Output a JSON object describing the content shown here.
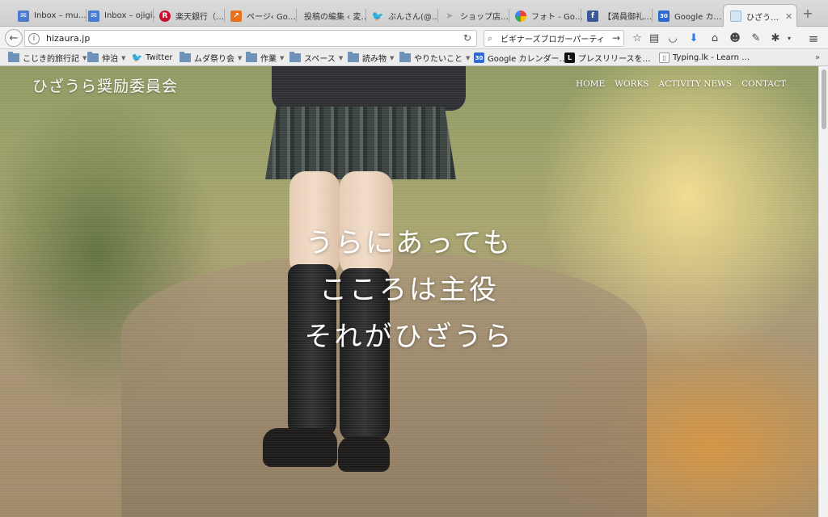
{
  "tabs": [
    {
      "label": "Inbox – mu…",
      "icon": "gmail-icon",
      "color": "#4a7bd0"
    },
    {
      "label": "Inbox – ojigi…",
      "icon": "gmail-icon",
      "color": "#4a7bd0"
    },
    {
      "label": "楽天銀行（…",
      "icon": "rakuten-icon",
      "color": "#c8102e"
    },
    {
      "label": "ページ‹ Go…",
      "icon": "analytics-icon",
      "color": "#e8711c"
    },
    {
      "label": "投稿の編集 ‹ 変…",
      "icon": "",
      "color": ""
    },
    {
      "label": "ぶんさん(@…",
      "icon": "twitter-icon",
      "color": "#1da1f2"
    },
    {
      "label": "ショップ店…",
      "icon": "send-icon",
      "color": "#9aa3ad"
    },
    {
      "label": "フォト - Go…",
      "icon": "photos-icon",
      "color": "#e3a21a"
    },
    {
      "label": "【満員御礼…",
      "icon": "facebook-icon",
      "color": "#3b5998"
    },
    {
      "label": "Google カ…",
      "icon": "calendar-icon",
      "color": "#2f6ad0"
    },
    {
      "label": "ひざう…",
      "icon": "page-icon",
      "color": "#8fb8d8",
      "active": true
    }
  ],
  "navbar": {
    "url": "hizaura.jp",
    "search_query": "ビギナーズブロガーパーティ"
  },
  "bookmarks": [
    {
      "label": "こじき的旅行記",
      "type": "folder"
    },
    {
      "label": "仲泊",
      "type": "folder"
    },
    {
      "label": "Twitter",
      "type": "twitter"
    },
    {
      "label": "ムダ祭り会",
      "type": "folder"
    },
    {
      "label": "作業",
      "type": "folder"
    },
    {
      "label": "スペース",
      "type": "folder"
    },
    {
      "label": "読み物",
      "type": "folder"
    },
    {
      "label": "やりたいこと",
      "type": "folder"
    },
    {
      "label": "Google カレンダー…",
      "type": "calendar"
    },
    {
      "label": "プレスリリースを…",
      "type": "l"
    },
    {
      "label": "Typing.lk - Learn …",
      "type": "page"
    }
  ],
  "site": {
    "title": "ひざうら奨励委員会",
    "nav": [
      "HOME",
      "WORKS",
      "ACTIVITY NEWS",
      "CONTACT"
    ],
    "hero_lines": [
      "うらにあっても",
      "こころは主役",
      "それがひざうら"
    ]
  }
}
